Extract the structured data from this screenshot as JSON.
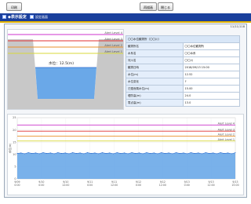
{
  "toolbar": {
    "print_label": "印刷",
    "refresh_label": "再描画",
    "close_label": "閉じる"
  },
  "title_bar": {
    "title": "◆表示設定",
    "subtitle": "設定画面"
  },
  "timestamp": "11/11/118",
  "diagram": {
    "level_label": "水位：12.5(m)",
    "alert_levels": [
      {
        "name": "Alert Level 4",
        "color": "#cc33cc"
      },
      {
        "name": "Alert Level 3",
        "color": "#e03030"
      },
      {
        "name": "Alert Level 2",
        "color": "#e8902a"
      },
      {
        "name": "Alert Level 1",
        "color": "#d8d83a"
      }
    ],
    "water_color": "#6aa8e8",
    "ground_color": "#c8c8c8"
  },
  "info": {
    "header": "〇〇水位観測所（〇〇川）",
    "rows": [
      {
        "label": "観測所名",
        "value": "〇〇水位観測所"
      },
      {
        "label": "水系名",
        "value": "〇〇水系"
      },
      {
        "label": "河川名",
        "value": "〇〇川"
      },
      {
        "label": "観測日時",
        "value": "2018/09/13 15:00"
      },
      {
        "label": "水位(m)",
        "value": "12.52"
      },
      {
        "label": "水位変化",
        "value": "↑"
      },
      {
        "label": "氾濫危険水位(m)",
        "value": "15.00"
      },
      {
        "label": "堤防高(m)",
        "value": "24.0"
      },
      {
        "label": "零点高(m)",
        "value": "13.0"
      }
    ]
  },
  "chart_data": {
    "type": "area",
    "ylabel": "水位(m)",
    "ylim": [
      0,
      25
    ],
    "yticks": [
      "0",
      "5",
      "10",
      "15",
      "20",
      "25"
    ],
    "xticks": [
      "9/09\n0:00",
      "9/10\n0:00",
      "9/10\n12:00",
      "9/11\n0:00",
      "9/11\n12:00",
      "9/12\n0:00",
      "9/12\n12:00",
      "9/13\n0:00",
      "9/13\n12:00",
      "9/13\n15:00"
    ],
    "alert_levels": [
      {
        "name": "Alert Level 4",
        "value": 22,
        "color": "#cc33cc"
      },
      {
        "name": "Alert Level 3",
        "value": 19.5,
        "color": "#e03030"
      },
      {
        "name": "Alert Level 2",
        "value": 17.5,
        "color": "#e8902a"
      },
      {
        "name": "Alert Level 1",
        "value": 15.5,
        "color": "#d8d83a"
      }
    ],
    "series": [
      {
        "values": [
          10.4,
          10.6,
          10.3,
          10.7,
          10.4,
          10.6,
          10.3,
          10.7,
          10.4,
          10.6,
          10.3,
          10.7,
          10.4,
          10.6,
          10.3,
          10.7,
          10.4,
          10.6,
          10.3,
          10.7,
          10.4,
          10.6,
          10.3,
          10.7,
          10.4,
          10.6,
          10.3,
          10.7,
          10.4,
          10.6,
          10.3,
          10.7,
          10.4,
          10.6,
          10.3,
          10.7,
          10.4,
          10.6,
          10.3,
          10.7,
          10.4,
          10.6,
          10.3,
          10.7,
          10.4,
          10.6,
          10.3,
          10.7,
          10.4,
          10.6,
          10.3,
          10.7,
          10.4,
          10.6,
          10.3,
          10.7,
          10.4,
          10.6,
          10.3,
          10.7
        ]
      }
    ],
    "area_color": "#6aa8e8",
    "line_color": "#2f6fd0",
    "grid": true,
    "legend_placement": "top-right"
  }
}
